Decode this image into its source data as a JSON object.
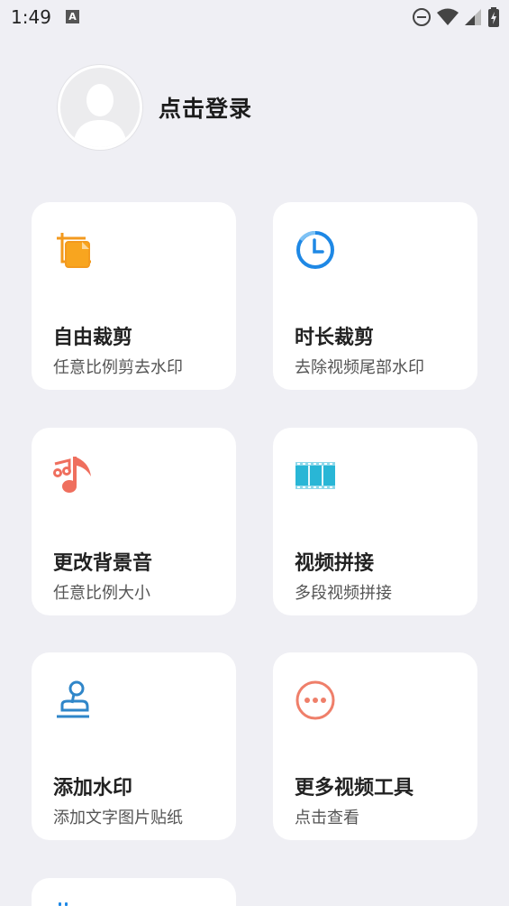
{
  "status": {
    "time": "1:49",
    "a_badge": "A"
  },
  "profile": {
    "login_label": "点击登录"
  },
  "cards": [
    {
      "title": "自由裁剪",
      "subtitle": "任意比例剪去水印",
      "icon": "crop-icon",
      "color": "#f39a1e"
    },
    {
      "title": "时长裁剪",
      "subtitle": "去除视频尾部水印",
      "icon": "clock-icon",
      "color": "#1e88e5"
    },
    {
      "title": "更改背景音",
      "subtitle": "任意比例大小",
      "icon": "music-icon",
      "color": "#ef6f5e"
    },
    {
      "title": "视频拼接",
      "subtitle": "多段视频拼接",
      "icon": "film-icon",
      "color": "#29b6d6"
    },
    {
      "title": "添加水印",
      "subtitle": "添加文字图片贴纸",
      "icon": "stamp-icon",
      "color": "#2f86c9"
    },
    {
      "title": "更多视频工具",
      "subtitle": "点击查看",
      "icon": "more-icon",
      "color": "#ef7f6a"
    }
  ]
}
